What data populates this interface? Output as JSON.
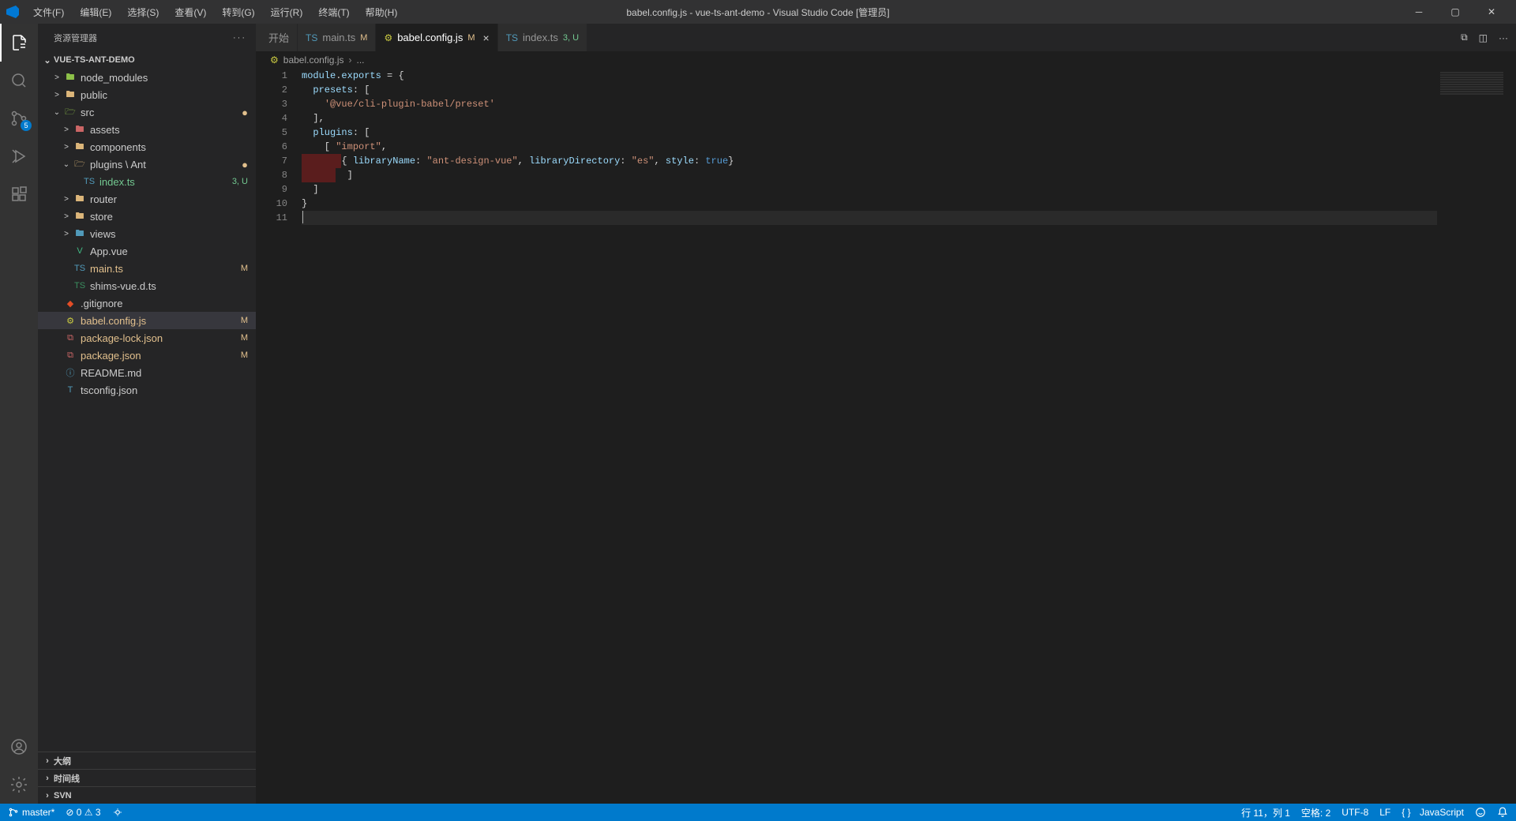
{
  "title": "babel.config.js - vue-ts-ant-demo - Visual Studio Code [管理员]",
  "menu": [
    "文件(F)",
    "编辑(E)",
    "选择(S)",
    "查看(V)",
    "转到(G)",
    "运行(R)",
    "终端(T)",
    "帮助(H)"
  ],
  "activity": {
    "scm_badge": "5"
  },
  "sidebar": {
    "title": "资源管理器",
    "project": "VUE-TS-ANT-DEMO",
    "bottom": [
      "大纲",
      "时间线",
      "SVN"
    ],
    "tree": [
      {
        "indent": 1,
        "label": "node_modules",
        "twisty": ">",
        "iconClass": "ic-folder-green",
        "icon": "🖿"
      },
      {
        "indent": 1,
        "label": "public",
        "twisty": ">",
        "iconClass": "ic-folder",
        "icon": "🖿"
      },
      {
        "indent": 1,
        "label": "src",
        "twisty": "⌄",
        "iconClass": "ic-folder-green",
        "icon": "🗁",
        "dot": true
      },
      {
        "indent": 2,
        "label": "assets",
        "twisty": ">",
        "iconClass": "ic-folder-red",
        "icon": "🖿"
      },
      {
        "indent": 2,
        "label": "components",
        "twisty": ">",
        "iconClass": "ic-folder",
        "icon": "🖿"
      },
      {
        "indent": 2,
        "label": "plugins \\ Ant",
        "twisty": "⌄",
        "iconClass": "ic-folder",
        "icon": "🗁",
        "dot": true
      },
      {
        "indent": 3,
        "label": "index.ts",
        "iconClass": "ic-ts",
        "icon": "TS",
        "badge": "3, U",
        "status": "untracked"
      },
      {
        "indent": 2,
        "label": "router",
        "twisty": ">",
        "iconClass": "ic-folder",
        "icon": "🖿"
      },
      {
        "indent": 2,
        "label": "store",
        "twisty": ">",
        "iconClass": "ic-folder",
        "icon": "🖿"
      },
      {
        "indent": 2,
        "label": "views",
        "twisty": ">",
        "iconClass": "ic-folder-blue",
        "icon": "🖿"
      },
      {
        "indent": 2,
        "label": "App.vue",
        "iconClass": "ic-vue",
        "icon": "V"
      },
      {
        "indent": 2,
        "label": "main.ts",
        "iconClass": "ic-ts",
        "icon": "TS",
        "badge": "M",
        "status": "modified"
      },
      {
        "indent": 2,
        "label": "shims-vue.d.ts",
        "iconClass": "ic-ts2",
        "icon": "TS"
      },
      {
        "indent": 1,
        "label": ".gitignore",
        "iconClass": "ic-git",
        "icon": "◆"
      },
      {
        "indent": 1,
        "label": "babel.config.js",
        "iconClass": "ic-js",
        "icon": "⚙",
        "badge": "M",
        "status": "modified",
        "selected": true
      },
      {
        "indent": 1,
        "label": "package-lock.json",
        "iconClass": "ic-json",
        "icon": "⧉",
        "badge": "M",
        "status": "modified"
      },
      {
        "indent": 1,
        "label": "package.json",
        "iconClass": "ic-json",
        "icon": "⧉",
        "badge": "M",
        "status": "modified"
      },
      {
        "indent": 1,
        "label": "README.md",
        "iconClass": "ic-md",
        "icon": "ⓘ"
      },
      {
        "indent": 1,
        "label": "tsconfig.json",
        "iconClass": "ic-ts",
        "icon": "T"
      }
    ]
  },
  "tabs": [
    {
      "icon": "◆",
      "iconClass": "ic-ts",
      "label": "开始",
      "vscode": true
    },
    {
      "icon": "TS",
      "iconClass": "ic-ts",
      "label": "main.ts",
      "badge": "M",
      "badgeClass": "modified"
    },
    {
      "icon": "⚙",
      "iconClass": "ic-js",
      "label": "babel.config.js",
      "badge": "M",
      "badgeClass": "modified",
      "active": true,
      "close": true
    },
    {
      "icon": "TS",
      "iconClass": "ic-ts",
      "label": "index.ts",
      "badge": "3, U",
      "badgeClass": "untracked"
    }
  ],
  "breadcrumb": {
    "file": "babel.config.js",
    "rest": "..."
  },
  "code": {
    "lines": [
      "1",
      "2",
      "3",
      "4",
      "5",
      "6",
      "7",
      "8",
      "9",
      "10",
      "11"
    ]
  },
  "status": {
    "branch": "master*",
    "errors": "⊘ 0 ⚠ 3",
    "cursor": "行 11，列 1",
    "spaces": "空格: 2",
    "encoding": "UTF-8",
    "eol": "LF",
    "lang_icon": "{ }",
    "lang": "JavaScript"
  }
}
